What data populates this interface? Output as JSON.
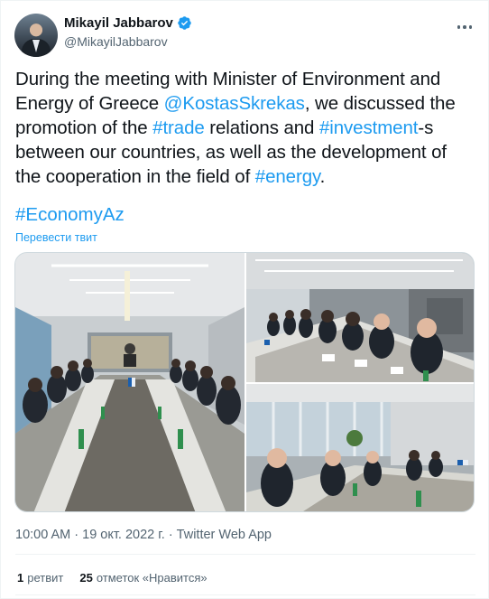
{
  "author": {
    "name": "Mikayil Jabbarov",
    "handle": "@MikayilJabbarov"
  },
  "tweet": {
    "t1": "During the meeting with Minister of Environment and Energy of Greece ",
    "mention": "@KostasSkrekas",
    "t2": ", we discussed the promotion of the ",
    "tag_trade": "#trade",
    "t3": " relations and ",
    "tag_investment": "#investment",
    "t4": "-s between our countries, as well as the development of the cooperation in the field of ",
    "tag_energy": "#energy",
    "t5": ".",
    "hashtag_line": "#EconomyAz",
    "translate_label": "Перевести твит"
  },
  "meta": {
    "timestamp": "10:00 AM · 19 окт. 2022 г. · Twitter Web App"
  },
  "stats": {
    "retweets_count": "1",
    "retweets_label": "ретвит",
    "likes_count": "25",
    "likes_label": "отметок «Нравится»"
  },
  "colors": {
    "link": "#1d9bf0",
    "text": "#0f1419",
    "secondary": "#536471"
  },
  "icons": {
    "verified": "verified-badge-icon",
    "more": "more-options-icon"
  }
}
